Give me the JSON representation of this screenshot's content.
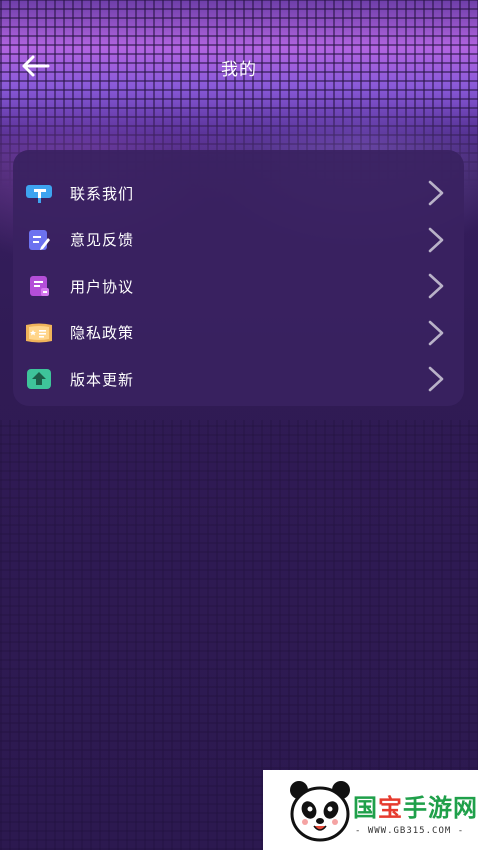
{
  "header": {
    "title": "我的"
  },
  "menu": {
    "items": [
      {
        "label": "联系我们",
        "icon": "contact-icon",
        "color": "#3ea4f0"
      },
      {
        "label": "意见反馈",
        "icon": "feedback-icon",
        "color": "#6c72f0"
      },
      {
        "label": "用户协议",
        "icon": "agreement-icon",
        "color": "#b44ed8"
      },
      {
        "label": "隐私政策",
        "icon": "privacy-icon",
        "color": "#f0b45a"
      },
      {
        "label": "版本更新",
        "icon": "update-icon",
        "color": "#3ec49a"
      }
    ]
  },
  "watermark": {
    "brand_green": "国",
    "brand_red": "宝",
    "brand_rest": "手游网",
    "url": "- WWW.GB315.COM -"
  },
  "colors": {
    "background": "#2e1a4f",
    "card": "#3a2261",
    "text": "#ffffff",
    "chevron": "#b9b2c8"
  }
}
